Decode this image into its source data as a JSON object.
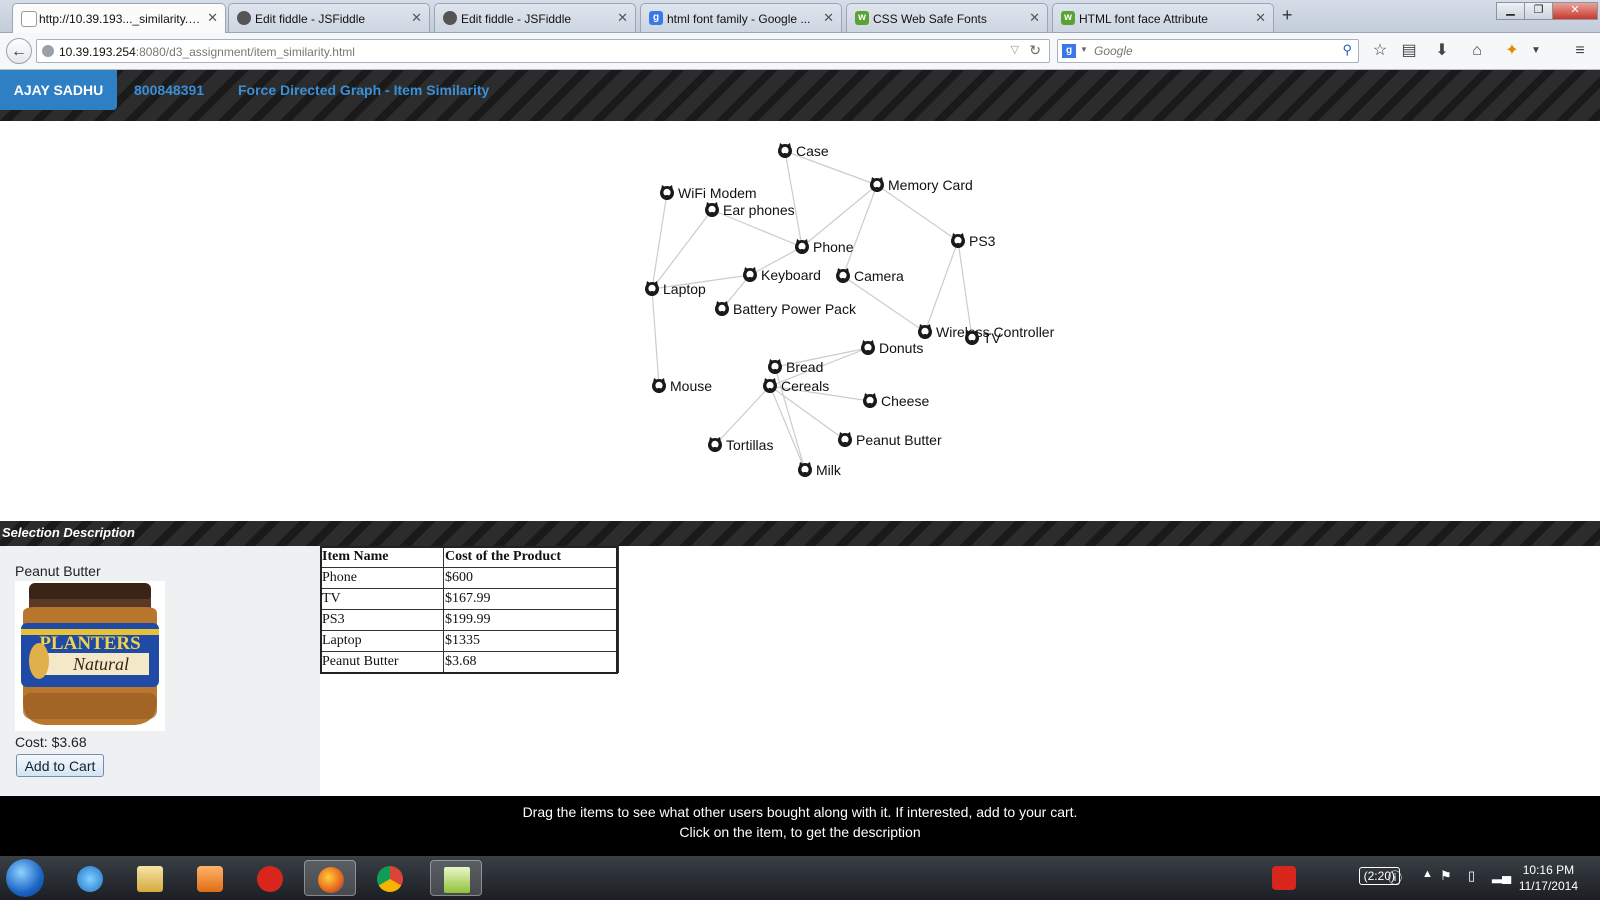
{
  "browser": {
    "tabs": [
      {
        "title": "http://10.39.193..._similarity.html",
        "favicon": "page-icon",
        "active": true
      },
      {
        "title": "Edit fiddle - JSFiddle",
        "favicon": "jsfiddle-icon",
        "active": false
      },
      {
        "title": "Edit fiddle - JSFiddle",
        "favicon": "jsfiddle-icon",
        "active": false
      },
      {
        "title": "html font family - Google ...",
        "favicon": "google-icon",
        "active": false
      },
      {
        "title": "CSS Web Safe Fonts",
        "favicon": "w3schools-icon",
        "active": false
      },
      {
        "title": "HTML font face Attribute",
        "favicon": "w3schools-icon",
        "active": false
      }
    ],
    "url_host": "10.39.193.254",
    "url_rest": ":8080/d3_assignment/item_similarity.html",
    "search_placeholder": "Google"
  },
  "header": {
    "name": "AJAY SADHU",
    "id": "800848391",
    "title": "Force Directed Graph - Item Similarity"
  },
  "graph": {
    "nodes": [
      {
        "id": "case",
        "label": "Case"
      },
      {
        "id": "memory_card",
        "label": "Memory Card"
      },
      {
        "id": "wifi_modem",
        "label": "WiFi Modem"
      },
      {
        "id": "ear_phones",
        "label": "Ear phones"
      },
      {
        "id": "phone",
        "label": "Phone"
      },
      {
        "id": "ps3",
        "label": "PS3"
      },
      {
        "id": "keyboard",
        "label": "Keyboard"
      },
      {
        "id": "camera",
        "label": "Camera"
      },
      {
        "id": "laptop",
        "label": "Laptop"
      },
      {
        "id": "battery",
        "label": "Battery Power Pack"
      },
      {
        "id": "wireless_controller",
        "label": "Wireless Controller"
      },
      {
        "id": "tv",
        "label": "TV"
      },
      {
        "id": "donuts",
        "label": "Donuts"
      },
      {
        "id": "bread",
        "label": "Bread"
      },
      {
        "id": "cereals",
        "label": "Cereals"
      },
      {
        "id": "mouse",
        "label": "Mouse"
      },
      {
        "id": "cheese",
        "label": "Cheese"
      },
      {
        "id": "peanut_butter",
        "label": "Peanut Butter"
      },
      {
        "id": "tortillas",
        "label": "Tortillas"
      },
      {
        "id": "milk",
        "label": "Milk"
      }
    ],
    "links": [
      [
        "case",
        "memory_card"
      ],
      [
        "case",
        "phone"
      ],
      [
        "memory_card",
        "phone"
      ],
      [
        "memory_card",
        "ps3"
      ],
      [
        "memory_card",
        "camera"
      ],
      [
        "ear_phones",
        "phone"
      ],
      [
        "ear_phones",
        "laptop"
      ],
      [
        "wifi_modem",
        "laptop"
      ],
      [
        "phone",
        "keyboard"
      ],
      [
        "keyboard",
        "laptop"
      ],
      [
        "keyboard",
        "battery"
      ],
      [
        "laptop",
        "mouse"
      ],
      [
        "camera",
        "wireless_controller"
      ],
      [
        "ps3",
        "wireless_controller"
      ],
      [
        "ps3",
        "tv"
      ],
      [
        "donuts",
        "bread"
      ],
      [
        "donuts",
        "cereals"
      ],
      [
        "cereals",
        "cheese"
      ],
      [
        "cereals",
        "peanut_butter"
      ],
      [
        "cereals",
        "tortillas"
      ],
      [
        "cereals",
        "milk"
      ],
      [
        "bread",
        "milk"
      ]
    ],
    "icon": "github-octocat-icon"
  },
  "selection": {
    "section_title": "Selection Description",
    "name": "Peanut Butter",
    "image_brand": "PLANTERS",
    "image_subtitle": "Natural",
    "cost": "Cost: $3.68",
    "add_to_cart": "Add to Cart"
  },
  "cart_table": {
    "headers": [
      "Item Name",
      "Cost of the Product"
    ],
    "rows": [
      [
        "Phone",
        "$600"
      ],
      [
        "TV",
        "$167.99"
      ],
      [
        "PS3",
        "$199.99"
      ],
      [
        "Laptop",
        "$1335"
      ],
      [
        "Peanut Butter",
        "$3.68"
      ]
    ]
  },
  "footer": {
    "line1": "Drag the items to see what other users bought along with it. If interested, add to your cart.",
    "line2": "Click on the item, to get the description"
  },
  "taskbar": {
    "battery": "(2:20)",
    "time": "10:16 PM",
    "date": "11/17/2014"
  },
  "colors": {
    "header_accent": "#3b8fd6",
    "name_button": "#2f7fc4"
  }
}
